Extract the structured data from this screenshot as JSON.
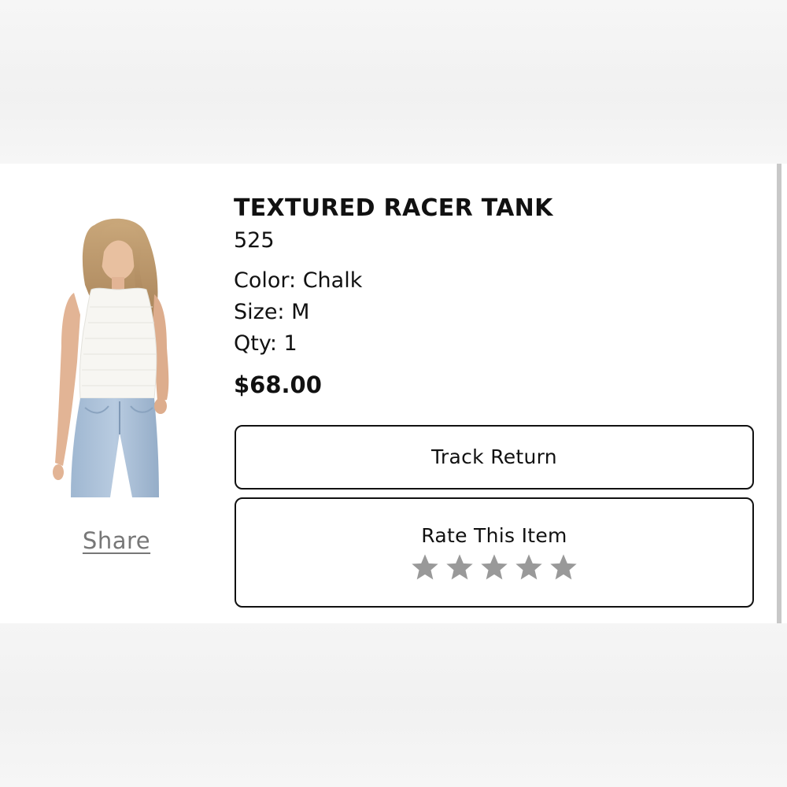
{
  "product": {
    "name": "TEXTURED RACER TANK",
    "code": "525",
    "color": "Color: Chalk",
    "size": "Size: M",
    "qty": "Qty: 1",
    "price": "$68.00",
    "image": "model-in-white-tank-and-jeans"
  },
  "actions": {
    "share_label": "Share",
    "track_return_label": "Track Return",
    "rate_label": "Rate This Item"
  },
  "rating": {
    "max": 5,
    "value": 0,
    "icon": "star-icon",
    "star_color": "#999999"
  },
  "colors": {
    "text": "#111111",
    "link": "#777777",
    "border": "#111111"
  }
}
